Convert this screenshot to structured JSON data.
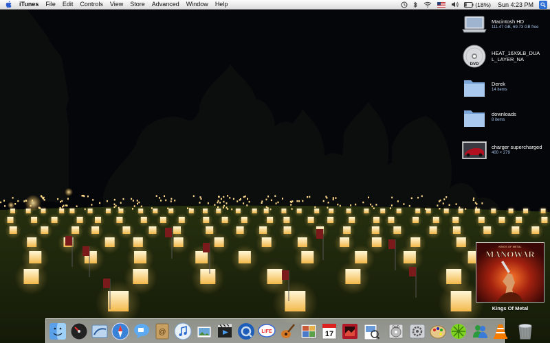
{
  "menubar": {
    "app_name": "iTunes",
    "menus": [
      "File",
      "Edit",
      "Controls",
      "View",
      "Store",
      "Advanced",
      "Window",
      "Help"
    ],
    "battery": "(18%)",
    "clock": "Sun 4:23 PM"
  },
  "desktop_icons": [
    {
      "name": "Macintosh HD",
      "info": "111.47 GB, 69.73 GB free",
      "icon": "hard-drive-icon"
    },
    {
      "name": "HEAT_16X9LB_DUAL_LAYER_NA",
      "info": "",
      "icon": "dvd-icon"
    },
    {
      "name": "Derek",
      "info": "14 items",
      "icon": "folder-icon"
    },
    {
      "name": "downloads",
      "info": "8 items",
      "icon": "folder-icon"
    },
    {
      "name": "charger supercharged",
      "info": "400 × 279",
      "icon": "image-file-icon"
    }
  ],
  "album": {
    "caption": "Kings Of Metal",
    "band": "MANOWAR",
    "subtitle": "KINGS OF METAL"
  },
  "dvd_label": "DVD",
  "calendar_day": "17",
  "dock": [
    "finder-icon",
    "dashboard-icon",
    "mail-icon",
    "safari-icon",
    "ichat-icon",
    "address-book-icon",
    "itunes-icon",
    "iphoto-icon",
    "imovie-icon",
    "quicktime-icon",
    "comic-life-icon",
    "garageband-icon",
    "photo-booth-icon",
    "ical-icon",
    "photo-editor-icon",
    "preview-icon",
    "dvd-player-icon",
    "system-preferences-icon",
    "color-picker-icon",
    "limewire-icon",
    "messenger-icon",
    "vlc-icon",
    "trash-icon"
  ],
  "colors": {
    "menubar": "#e9e9e9",
    "sky": "#05060a",
    "lantern": "#ffd56a",
    "grass": "#1d2a0e",
    "spotlight": "#2f6fd6"
  }
}
